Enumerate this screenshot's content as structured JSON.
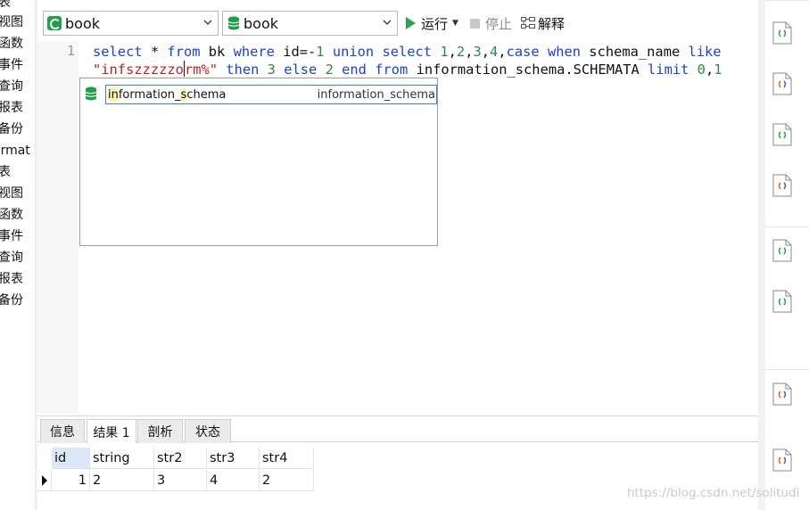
{
  "left_nav": {
    "items": [
      "表",
      "视图",
      "函数",
      "事件",
      "查询",
      "报表",
      "备份",
      "ormat",
      "表",
      "视图",
      "函数",
      "事件",
      "查询",
      "报表",
      "备份"
    ]
  },
  "toolbar": {
    "connection": "book",
    "database": "book",
    "run_label": "运行",
    "stop_label": "停止",
    "explain_label": "解释"
  },
  "editor": {
    "line_number": "1",
    "query_line1": "select * from bk where id=-1 union select 1,2,3,4,case when schema_name like",
    "query_line2": "\"infszzzzzorm%\" then 3 else 2 end from information_schema.SCHEMATA limit 0,1"
  },
  "autocomplete": {
    "item_prefix": "in",
    "item_middle": "formation_",
    "item_s": "s",
    "item_rest": "chema",
    "item_type": "information_schema"
  },
  "result_tabs": [
    "信息",
    "结果 1",
    "剖析",
    "状态"
  ],
  "result_table": {
    "columns": [
      "id",
      "string",
      "str2",
      "str3",
      "str4"
    ],
    "rows": [
      [
        "1",
        "2",
        "3",
        "4",
        "2"
      ]
    ]
  },
  "watermark": "https://blog.csdn.net/solitudi",
  "colors": {
    "keyword": "#1b3fd8",
    "number": "#2f8a46",
    "string": "#b3261e",
    "run_green": "#2ea44f",
    "selection_blue": "#3e7be3"
  }
}
